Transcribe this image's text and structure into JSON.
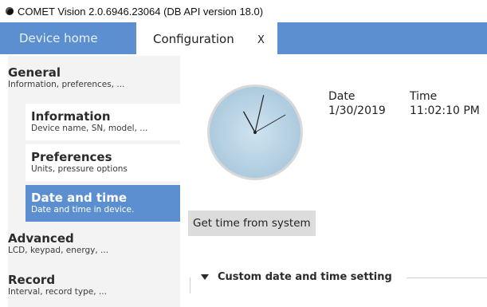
{
  "window": {
    "title": "COMET Vision 2.0.6946.23064 (DB API version 18.0)"
  },
  "tabs": {
    "home_label": "Device home",
    "config_label": "Configuration",
    "close_label": "X"
  },
  "sidebar": {
    "items": [
      {
        "title": "General",
        "subtitle": "Information, preferences, ..."
      },
      {
        "title": "Information",
        "subtitle": "Device name, SN, model, ..."
      },
      {
        "title": "Preferences",
        "subtitle": "Units, pressure options"
      },
      {
        "title": "Date and time",
        "subtitle": "Date and time in device."
      },
      {
        "title": "Advanced",
        "subtitle": "LCD, keypad, energy, ..."
      },
      {
        "title": "Record",
        "subtitle": "Interval, record type, ..."
      }
    ]
  },
  "datetime": {
    "date_label": "Date",
    "date_value": "1/30/2019",
    "time_label": "Time",
    "time_value": "11:02:10 PM",
    "clock_time": "11:02:10"
  },
  "buttons": {
    "get_time_label": "Get time from system"
  },
  "custom_group": {
    "title": "Custom date and time setting"
  },
  "colors": {
    "accent": "#5b8fd0",
    "sidebar_bg": "#f3f3f3",
    "button_bg": "#dcdcdc"
  }
}
